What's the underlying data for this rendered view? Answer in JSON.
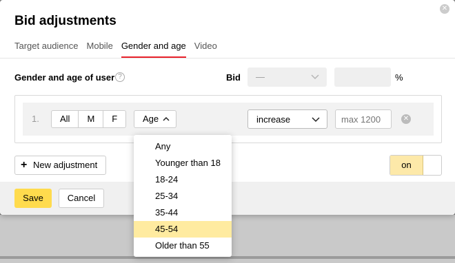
{
  "dialog": {
    "title": "Bid adjustments",
    "close_glyph": "✕"
  },
  "tabs": [
    {
      "label": "Target audience",
      "active": false
    },
    {
      "label": "Mobile",
      "active": false
    },
    {
      "label": "Gender and age",
      "active": true
    },
    {
      "label": "Video",
      "active": false
    }
  ],
  "section": {
    "label": "Gender and age of user",
    "help_glyph": "?",
    "bid_label": "Bid",
    "bid_select_value": "—",
    "percent": "%"
  },
  "rule": {
    "number": "1.",
    "gender_options": [
      "All",
      "M",
      "F"
    ],
    "age_label": "Age",
    "direction": "increase",
    "max_placeholder": "max 1200",
    "remove_glyph": "✕"
  },
  "age_dropdown": {
    "options": [
      "Any",
      "Younger than 18",
      "18-24",
      "25-34",
      "35-44",
      "45-54",
      "Older than 55"
    ],
    "selected": "45-54"
  },
  "new_adjustment_label": "New adjustment",
  "toggle_label": "on",
  "footer": {
    "save_label": "Save",
    "cancel_label": "Cancel"
  },
  "colors": {
    "tab_active_underline": "#e8202a",
    "save_button": "#ffdb4d",
    "dropdown_selected": "#ffeba0",
    "toggle_on": "#fde9a9"
  }
}
